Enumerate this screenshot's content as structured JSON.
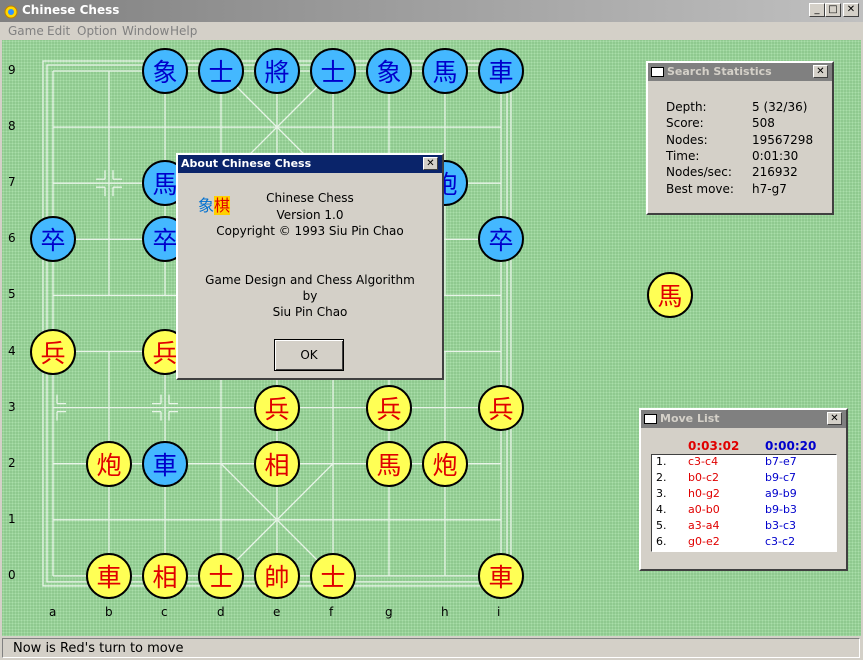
{
  "app": {
    "title": "Chinese Chess"
  },
  "menu": [
    "Game",
    "Edit",
    "Option",
    "Window",
    "Help"
  ],
  "board": {
    "ranks": [
      "9",
      "8",
      "7",
      "6",
      "5",
      "4",
      "3",
      "2",
      "1",
      "0"
    ],
    "files": [
      "a",
      "b",
      "c",
      "d",
      "e",
      "f",
      "g",
      "h",
      "i"
    ],
    "pieces": [
      {
        "sq": "c9",
        "char": "象",
        "color": "blue"
      },
      {
        "sq": "d9",
        "char": "士",
        "color": "blue"
      },
      {
        "sq": "e9",
        "char": "將",
        "color": "blue"
      },
      {
        "sq": "f9",
        "char": "士",
        "color": "blue"
      },
      {
        "sq": "g9",
        "char": "象",
        "color": "blue"
      },
      {
        "sq": "h9",
        "char": "馬",
        "color": "blue"
      },
      {
        "sq": "i9",
        "char": "車",
        "color": "blue"
      },
      {
        "sq": "c7",
        "char": "馬",
        "color": "blue"
      },
      {
        "sq": "h7",
        "char": "炮",
        "color": "blue"
      },
      {
        "sq": "a6",
        "char": "卒",
        "color": "blue"
      },
      {
        "sq": "c6",
        "char": "卒",
        "color": "blue"
      },
      {
        "sq": "i6",
        "char": "卒",
        "color": "blue"
      },
      {
        "sq": "a4",
        "char": "兵",
        "color": "red"
      },
      {
        "sq": "c4",
        "char": "兵",
        "color": "red"
      },
      {
        "sq": "e3",
        "char": "兵",
        "color": "red"
      },
      {
        "sq": "g3",
        "char": "兵",
        "color": "red"
      },
      {
        "sq": "i3",
        "char": "兵",
        "color": "red"
      },
      {
        "sq": "b2",
        "char": "炮",
        "color": "red"
      },
      {
        "sq": "c2",
        "char": "車",
        "color": "blue"
      },
      {
        "sq": "e2",
        "char": "相",
        "color": "red"
      },
      {
        "sq": "g2",
        "char": "馬",
        "color": "red"
      },
      {
        "sq": "h2",
        "char": "炮",
        "color": "red"
      },
      {
        "sq": "b0",
        "char": "車",
        "color": "red"
      },
      {
        "sq": "c0",
        "char": "相",
        "color": "red"
      },
      {
        "sq": "d0",
        "char": "士",
        "color": "red"
      },
      {
        "sq": "e0",
        "char": "帥",
        "color": "red"
      },
      {
        "sq": "f0",
        "char": "士",
        "color": "red"
      },
      {
        "sq": "i0",
        "char": "車",
        "color": "red"
      }
    ],
    "captured": [
      {
        "char": "馬",
        "color": "red"
      }
    ]
  },
  "colors": {
    "board_bg": "#8fc98f",
    "red_piece": "#ffff55",
    "blue_piece": "#44b8ff",
    "red_text": "#e00000",
    "blue_text": "#0000cc"
  },
  "about": {
    "title": "About Chinese Chess",
    "logo": "象棋",
    "lines": [
      "Chinese Chess",
      "Version 1.0",
      "Copyright © 1993 Siu Pin Chao",
      "Game Design and Chess Algorithm",
      "by",
      "Siu Pin Chao"
    ],
    "ok_label": "OK"
  },
  "search_stats": {
    "title": "Search Statistics",
    "rows": [
      {
        "label": "Depth:",
        "value": "5  (32/36)"
      },
      {
        "label": "Score:",
        "value": "508"
      },
      {
        "label": "Nodes:",
        "value": "19567298"
      },
      {
        "label": "Time:",
        "value": "0:01:30"
      },
      {
        "label": "Nodes/sec:",
        "value": "216932"
      },
      {
        "label": "Best move:",
        "value": "h7-g7"
      }
    ]
  },
  "move_list": {
    "title": "Move List",
    "red_time": "0:03:02",
    "blue_time": "0:00:20",
    "moves": [
      {
        "num": "1.",
        "red": "c3-c4",
        "blue": "b7-e7"
      },
      {
        "num": "2.",
        "red": "b0-c2",
        "blue": "b9-c7"
      },
      {
        "num": "3.",
        "red": "h0-g2",
        "blue": "a9-b9"
      },
      {
        "num": "4.",
        "red": "a0-b0",
        "blue": "b9-b3"
      },
      {
        "num": "5.",
        "red": "a3-a4",
        "blue": "b3-c3"
      },
      {
        "num": "6.",
        "red": "g0-e2",
        "blue": "c3-c2"
      }
    ]
  },
  "status": "Now is Red's turn to move"
}
